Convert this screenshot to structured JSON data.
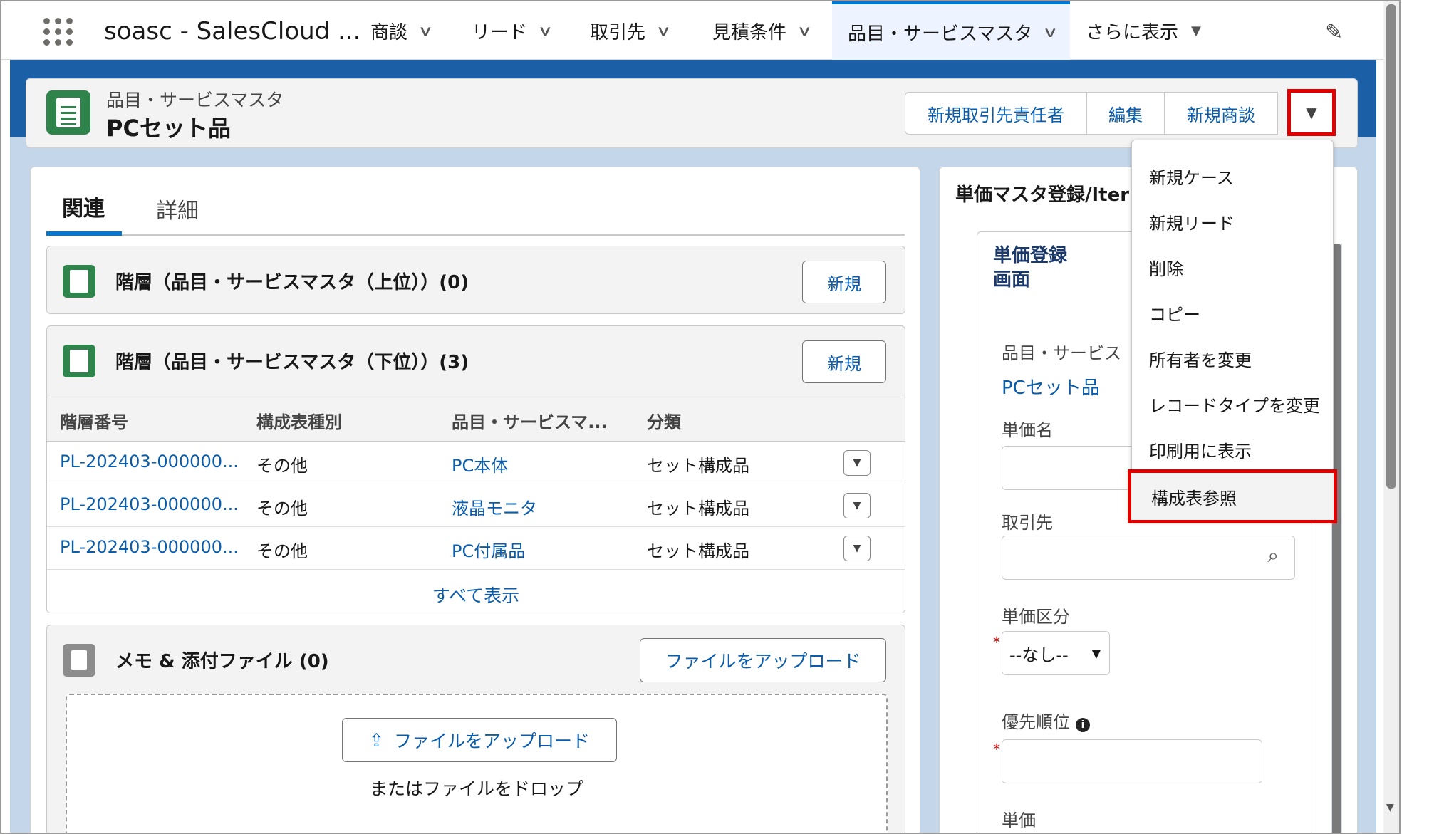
{
  "app": {
    "name": "soasc - SalesCloud ..."
  },
  "nav": {
    "tabs": [
      {
        "label": "商談"
      },
      {
        "label": "リード"
      },
      {
        "label": "取引先"
      },
      {
        "label": "見積条件"
      },
      {
        "label": "品目・サービスマスタ"
      }
    ],
    "more_label": "さらに表示"
  },
  "record": {
    "type": "品目・サービスマスタ",
    "title": "PCセット品",
    "actions": [
      "新規取引先責任者",
      "編集",
      "新規商談"
    ]
  },
  "menu": {
    "items": [
      "新規ケース",
      "新規リード",
      "削除",
      "コピー",
      "所有者を変更",
      "レコードタイプを変更",
      "印刷用に表示",
      "構成表参照"
    ],
    "highlighted": "構成表参照"
  },
  "tabs": {
    "related": "関連",
    "detail": "詳細"
  },
  "upper": {
    "title": "階層（品目・サービスマスタ（上位））(0)",
    "new_label": "新規"
  },
  "lower": {
    "title": "階層（品目・サービスマスタ（下位））(3)",
    "new_label": "新規",
    "columns": [
      "階層番号",
      "構成表種別",
      "品目・サービスマ...",
      "分類"
    ],
    "rows": [
      {
        "number": "PL-202403-000000...",
        "kind": "その他",
        "item": "PC本体",
        "category": "セット構成品"
      },
      {
        "number": "PL-202403-000000...",
        "kind": "その他",
        "item": "液晶モニタ",
        "category": "セット構成品"
      },
      {
        "number": "PL-202403-000000...",
        "kind": "その他",
        "item": "PC付属品",
        "category": "セット構成品"
      }
    ],
    "view_all": "すべて表示"
  },
  "files": {
    "title": "メモ & 添付ファイル (0)",
    "upload_label": "ファイルをアップロード",
    "drop_text": "またはファイルをドロップ"
  },
  "right": {
    "title": "単価マスタ登録/Iter",
    "inner_title_1": "単価登録",
    "inner_title_2": "画面",
    "item_label": "品目・サービス",
    "item_value": "PCセット品",
    "price_name_label": "単価名",
    "account_label": "取引先",
    "price_type_label": "単価区分",
    "price_type_value": "--なし--",
    "priority_label": "優先順位",
    "unit_price_label": "単価",
    "required_mark": "*"
  },
  "colors": {
    "accent": "#0176d3",
    "link": "#0b5cab",
    "highlight": "#e00000",
    "brand_band": "#1b5fa7",
    "record_icon": "#2e844a"
  },
  "icons": [
    "app-launcher-icon",
    "chevron-down-icon",
    "pencil-icon",
    "record-icon",
    "file-icon",
    "upload-icon",
    "search-icon",
    "info-icon"
  ]
}
